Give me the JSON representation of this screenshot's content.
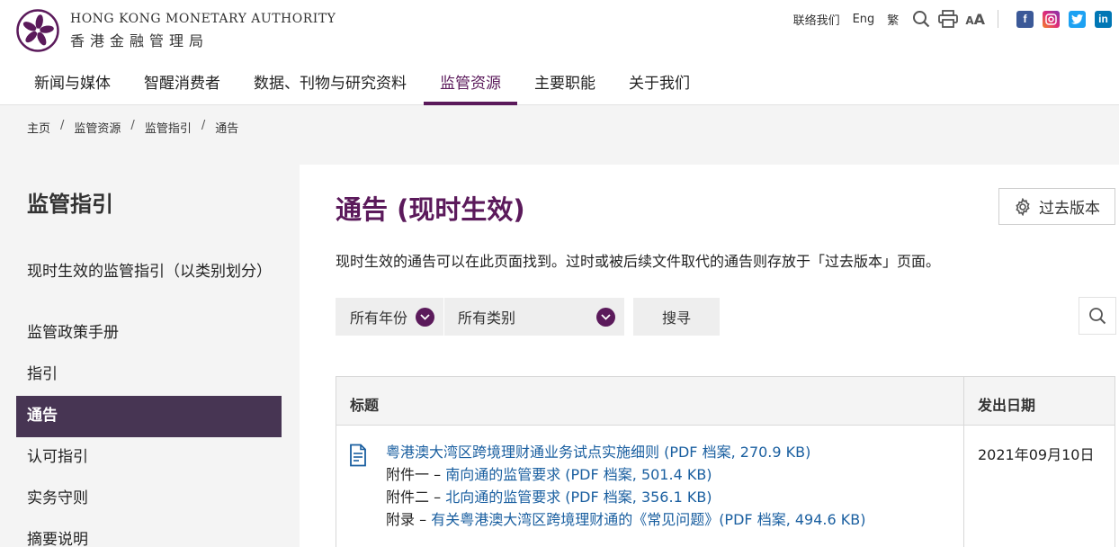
{
  "header": {
    "org_en": "HONG KONG MONETARY AUTHORITY",
    "org_zh": "香港金融管理局",
    "utility": {
      "contact": "联络我们",
      "eng": "Eng",
      "trad": "繁",
      "font_size": "AA"
    },
    "social": [
      {
        "name": "facebook",
        "glyph": "f",
        "color": "#3b5998"
      },
      {
        "name": "instagram",
        "glyph": "◎",
        "color": "#d6249f"
      },
      {
        "name": "twitter",
        "glyph": "t",
        "color": "#1da1f2"
      },
      {
        "name": "linkedin",
        "glyph": "in",
        "color": "#0077b5"
      }
    ],
    "nav": [
      "新闻与媒体",
      "智醒消费者",
      "数据、刊物与研究资料",
      "监管资源",
      "主要职能",
      "关于我们"
    ],
    "nav_active": "监管资源"
  },
  "breadcrumb": [
    "主页",
    "监管资源",
    "监管指引",
    "通告"
  ],
  "sidebar": {
    "title": "监管指引",
    "items": [
      "现时生效的监管指引（以类别划分）",
      "监管政策手册",
      "指引",
      "通告",
      "认可指引",
      "实务守则",
      "摘要说明"
    ],
    "active": "通告"
  },
  "main": {
    "title": "通告 (现时生效)",
    "past_versions": "过去版本",
    "intro": "现时生效的通告可以在此页面找到。过时或被后续文件取代的通告则存放于「过去版本」页面。",
    "filters": {
      "year": "所有年份",
      "category": "所有类别",
      "search": "搜寻"
    },
    "table": {
      "headers": [
        "标题",
        "发出日期"
      ],
      "rows": [
        {
          "title": "粤港澳大湾区跨境理财通业务试点实施细则 (PDF 档案, 270.9 KB)",
          "annexes": [
            {
              "prefix": "附件一 – ",
              "text": "南向通的监管要求 (PDF 档案, 501.4 KB)"
            },
            {
              "prefix": "附件二 – ",
              "text": "北向通的监管要求 (PDF 档案, 356.1 KB)"
            },
            {
              "prefix": "附录 – ",
              "text": "有关粤港澳大湾区跨境理财通的《常见问题》(PDF 档案, 494.6 KB)"
            }
          ],
          "date": "2021年09月10日"
        }
      ]
    }
  },
  "colors": {
    "brand_purple": "#5b1a5b",
    "sidebar_active": "#473553",
    "link_blue": "#1a5fa0"
  }
}
